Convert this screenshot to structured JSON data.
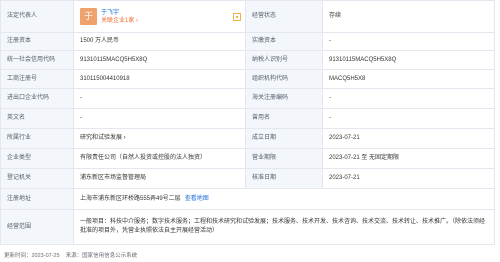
{
  "legal_rep": {
    "label": "法定代表人",
    "avatar_char": "于",
    "name": "于飞宇",
    "related_link": "关联企业1家 ›"
  },
  "status": {
    "label": "经营状态",
    "value": "存续"
  },
  "registered_capital": {
    "label": "注册资本",
    "value": "1500 万人民币"
  },
  "paid_capital": {
    "label": "实缴资本",
    "value": "-"
  },
  "credit_code": {
    "label": "统一社会信用代码",
    "value": "91310115MACQ5H5X8Q"
  },
  "taxpayer_id": {
    "label": "纳税人识别号",
    "value": "91310115MACQ5H5X8Q"
  },
  "business_reg_no": {
    "label": "工商注册号",
    "value": "310115004410918"
  },
  "org_code": {
    "label": "组织机构代码",
    "value": "MACQ5H5X8"
  },
  "import_export_code": {
    "label": "进出口企业代码",
    "value": "-"
  },
  "customs_code": {
    "label": "海关注册编码",
    "value": "-"
  },
  "english_name": {
    "label": "英文名",
    "value": "-"
  },
  "former_name": {
    "label": "曾用名",
    "value": "-"
  },
  "industry": {
    "label": "所属行业",
    "value": "研究和试验发展 ›"
  },
  "established_date": {
    "label": "成立日期",
    "value": "2023-07-21"
  },
  "company_type": {
    "label": "企业类型",
    "value": "有限责任公司（自然人投资或控股的法人独资）"
  },
  "business_term": {
    "label": "营业期限",
    "value": "2023-07-21 至 无固定期限"
  },
  "registration_authority": {
    "label": "登记机关",
    "value": "浦东新区市场监督管理局"
  },
  "approval_date": {
    "label": "核准日期",
    "value": "2023-07-21"
  },
  "address": {
    "label": "注册地址",
    "value": "上海市浦东新区环桥路555弄49号二层",
    "map_link": "查看地图"
  },
  "scope": {
    "label": "经营范围",
    "value": "一般项目：科技中介服务；数字技术服务；工程和技术研究和试验发展；技术服务、技术开发、技术咨询、技术交流、技术转让、技术推广。（除依法须经批准的项目外，凭营业执照依法自主开展经营活动）"
  },
  "footer": {
    "updated": "更新时间：2023-07-25",
    "source": "来源：国家信用信息公示系统"
  }
}
